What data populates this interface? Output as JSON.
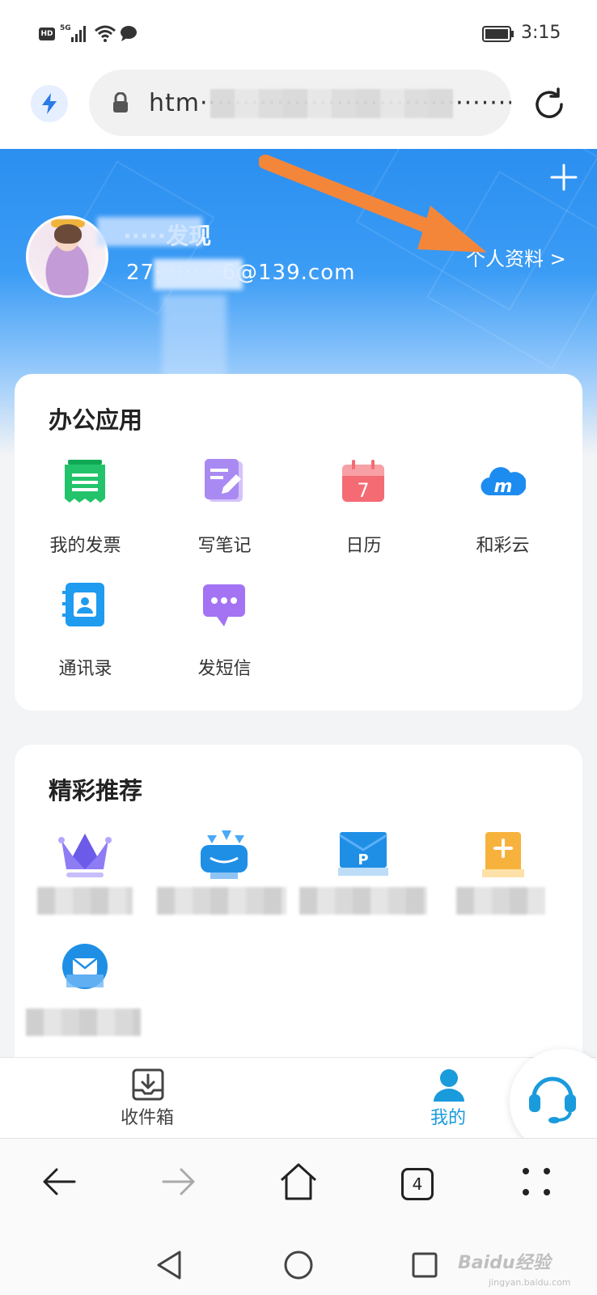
{
  "status_bar": {
    "hd": "HD",
    "network": "5G",
    "time": "3:15"
  },
  "address_bar": {
    "url": "htm········································l/wel"
  },
  "profile": {
    "name": "·····发现",
    "email": "27·········6@139.com",
    "profile_link": "个人资料 >"
  },
  "office": {
    "title": "办公应用",
    "apps": [
      {
        "label": "我的发票",
        "icon": "invoice-icon"
      },
      {
        "label": "写笔记",
        "icon": "note-icon"
      },
      {
        "label": "日历",
        "icon": "calendar-icon",
        "day": "7"
      },
      {
        "label": "和彩云",
        "icon": "cloud-icon"
      },
      {
        "label": "通讯录",
        "icon": "contacts-icon"
      },
      {
        "label": "发短信",
        "icon": "sms-icon"
      }
    ]
  },
  "recommend": {
    "title": "精彩推荐",
    "items": [
      {
        "icon": "crown-icon"
      },
      {
        "icon": "gift-box-icon"
      },
      {
        "icon": "card-icon"
      },
      {
        "icon": "plus-folder-icon"
      },
      {
        "icon": "mail-icon"
      }
    ]
  },
  "tabbar": {
    "inbox_label": "收件箱",
    "me_label": "我的"
  },
  "browser_toolbar": {
    "tab_count": "4"
  },
  "watermark": {
    "brand": "Baidu经验",
    "url": "jingyan.baidu.com"
  },
  "colors": {
    "primary": "#2b8ff0",
    "active_tab": "#1a9bdc",
    "arrow": "#f4863a"
  }
}
